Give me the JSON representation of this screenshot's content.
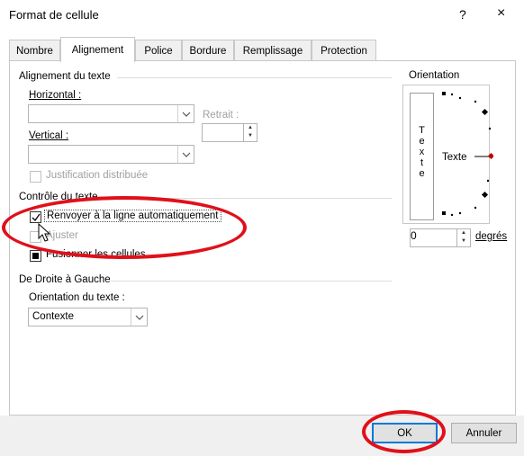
{
  "window": {
    "title": "Format de cellule",
    "help": "?",
    "close": "×"
  },
  "tabs": [
    "Nombre",
    "Alignement",
    "Police",
    "Bordure",
    "Remplissage",
    "Protection"
  ],
  "alignment": {
    "section_title": "Alignement du texte",
    "horizontal_label": "Horizontal :",
    "horizontal_value": "",
    "indent_label": "Retrait :",
    "indent_value": "",
    "vertical_label": "Vertical :",
    "vertical_value": "",
    "distributed_label": "Justification distribuée"
  },
  "text_control": {
    "section_title": "Contrôle du texte",
    "wrap_label": "Renvoyer à la ligne automatiquement",
    "wrap_checked": true,
    "shrink_label": "Ajuster",
    "merge_label": "Fusionner les cellules",
    "merge_state": "indeterminate"
  },
  "rtl": {
    "section_title": "De Droite à Gauche",
    "direction_label": "Orientation du texte :",
    "direction_value": "Contexte"
  },
  "orientation": {
    "section_title": "Orientation",
    "vertical_letters": [
      "T",
      "e",
      "x",
      "t",
      "e"
    ],
    "dial_label": "Texte",
    "degrees_value": "0",
    "degrees_label": "degrés"
  },
  "buttons": {
    "ok": "OK",
    "cancel": "Annuler"
  },
  "colors": {
    "dial_marker": "#c00000",
    "highlight_oval": "#e0101a",
    "focus_blue": "#0078d7"
  },
  "icons": [
    "help-icon",
    "close-icon",
    "chevron-down-icon",
    "spin-up-icon",
    "spin-down-icon",
    "checkmark-icon",
    "mouse-cursor-icon"
  ]
}
